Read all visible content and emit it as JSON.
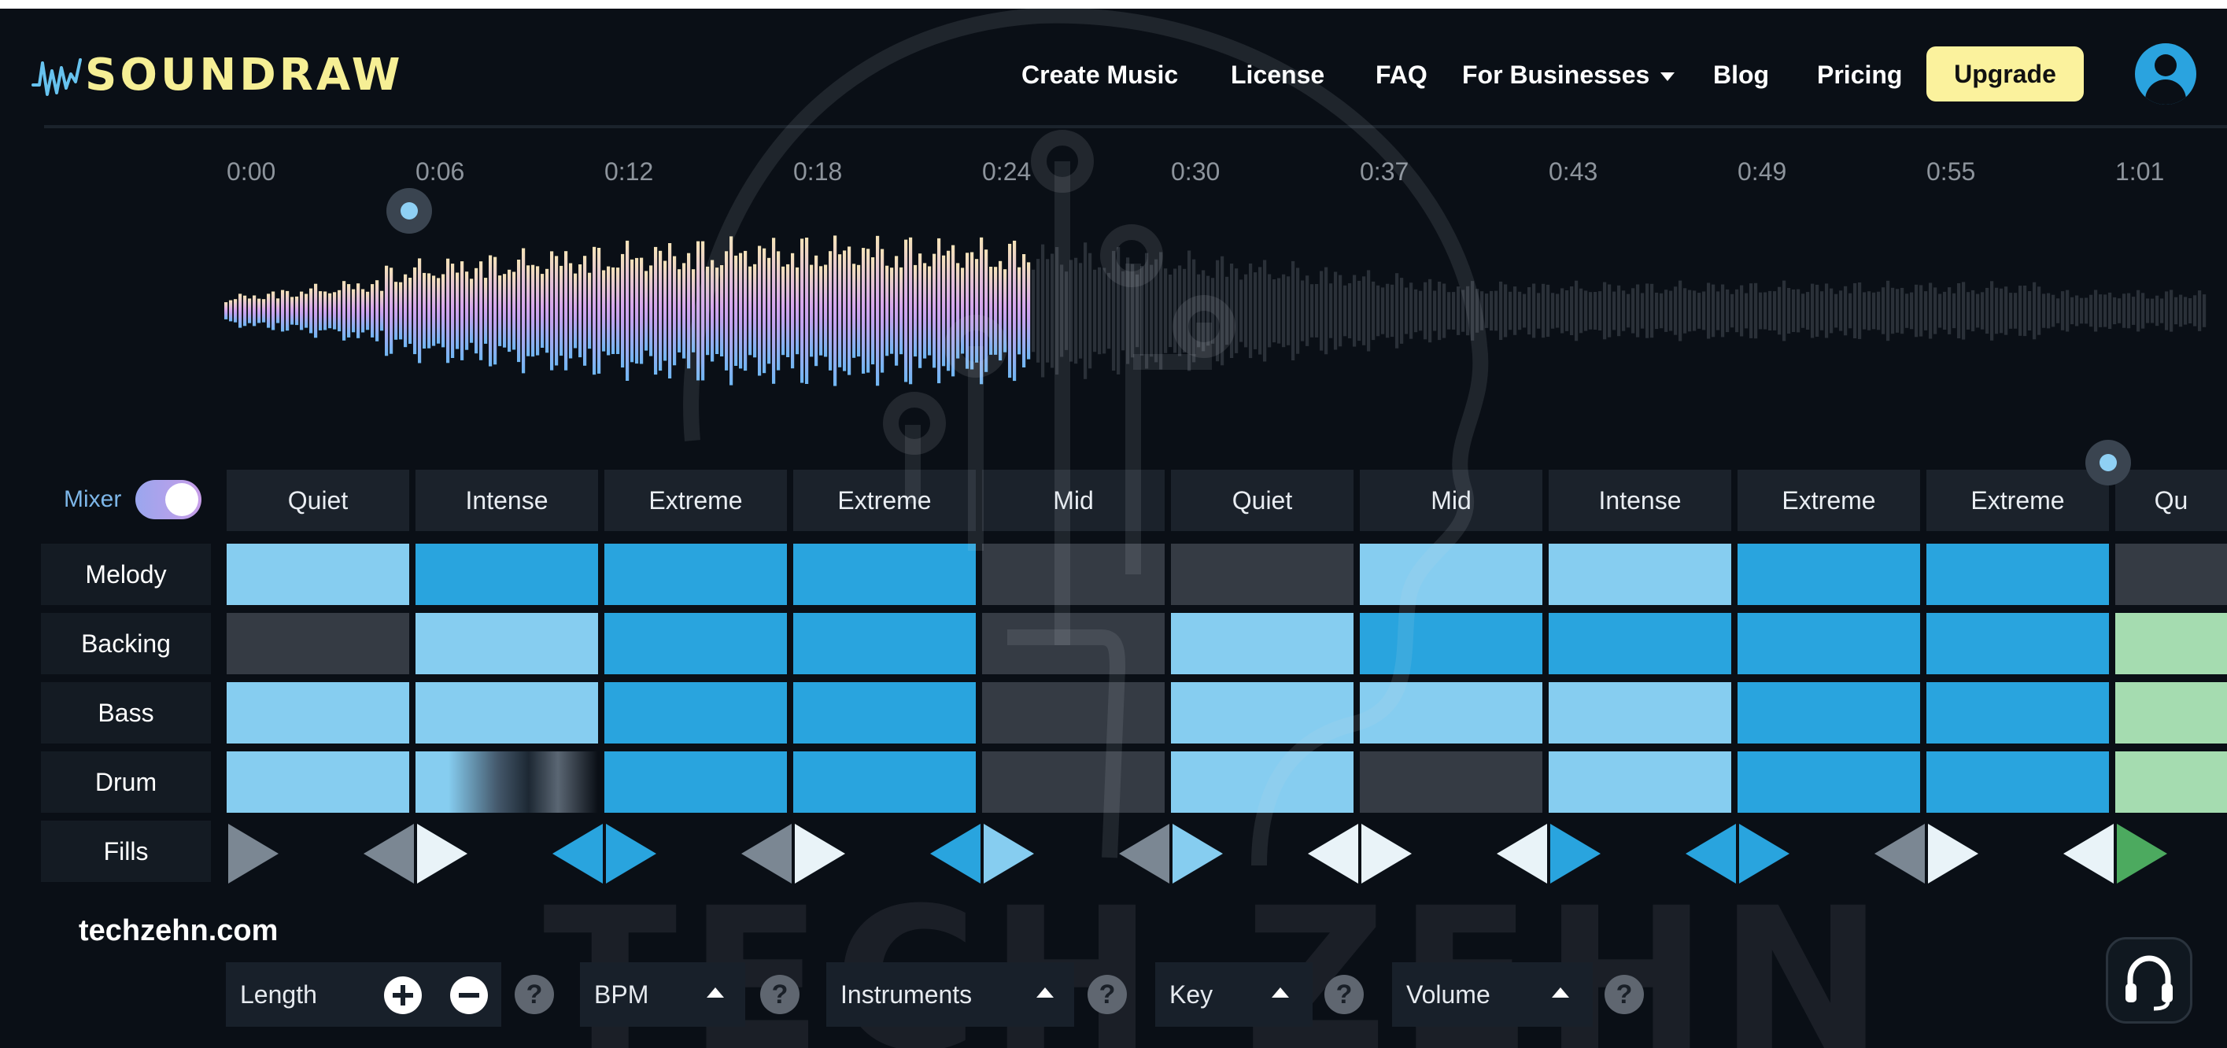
{
  "header": {
    "logo_text": "SOUNDRAW",
    "nav": {
      "create_music": "Create Music",
      "license": "License",
      "faq": "FAQ",
      "for_businesses": "For Businesses",
      "blog": "Blog",
      "pricing": "Pricing"
    },
    "upgrade_label": "Upgrade",
    "avatar_icon": "user-icon"
  },
  "timeline": {
    "ticks": [
      "0:00",
      "0:06",
      "0:12",
      "0:18",
      "0:24",
      "0:30",
      "0:37",
      "0:43",
      "0:49",
      "0:55",
      "1:01"
    ]
  },
  "mixer": {
    "label": "Mixer",
    "enabled": true,
    "segments": [
      "Quiet",
      "Intense",
      "Extreme",
      "Extreme",
      "Mid",
      "Quiet",
      "Mid",
      "Intense",
      "Extreme",
      "Extreme",
      "Qu"
    ],
    "tracks": [
      {
        "name": "Melody",
        "cells": [
          "light",
          "mid",
          "mid",
          "mid",
          "dark",
          "dark",
          "light",
          "light",
          "mid",
          "mid",
          "dark"
        ]
      },
      {
        "name": "Backing",
        "cells": [
          "dark",
          "light",
          "mid",
          "mid",
          "dark",
          "light",
          "mid",
          "mid",
          "mid",
          "mid",
          "green"
        ]
      },
      {
        "name": "Bass",
        "cells": [
          "light",
          "light",
          "mid",
          "mid",
          "dark",
          "light",
          "light",
          "light",
          "mid",
          "mid",
          "green"
        ]
      },
      {
        "name": "Drum",
        "cells": [
          "light",
          "fade",
          "mid",
          "mid",
          "dark",
          "light",
          "dark",
          "light",
          "mid",
          "mid",
          "green"
        ]
      }
    ],
    "fills_label": "Fills",
    "fills": [
      {
        "left": "none",
        "right": "gray"
      },
      {
        "left": "gray",
        "right": "white"
      },
      {
        "left": "blue",
        "right": "blue"
      },
      {
        "left": "gray",
        "right": "white"
      },
      {
        "left": "blue",
        "right": "lightblue"
      },
      {
        "left": "gray",
        "right": "lightblue"
      },
      {
        "left": "white",
        "right": "white"
      },
      {
        "left": "white",
        "right": "blue"
      },
      {
        "left": "blue",
        "right": "blue"
      },
      {
        "left": "gray",
        "right": "white"
      },
      {
        "left": "white",
        "right": "green"
      }
    ],
    "colors": {
      "light": "#86cdf0",
      "mid": "#29a4de",
      "dark": "#353b44",
      "green": "#a5dcb0",
      "gray": "#7b8793",
      "white": "#e9f3f8",
      "blue": "#29a4de",
      "lightblue": "#86cdf0",
      "fill_green": "#4caa5f"
    }
  },
  "controls": {
    "length": "Length",
    "bpm": "BPM",
    "instruments": "Instruments",
    "key": "Key",
    "volume": "Volume",
    "help_symbol": "?"
  },
  "watermark": {
    "site": "techzehn.com",
    "text": "TECH ZEHN"
  },
  "support_icon": "headset-icon"
}
